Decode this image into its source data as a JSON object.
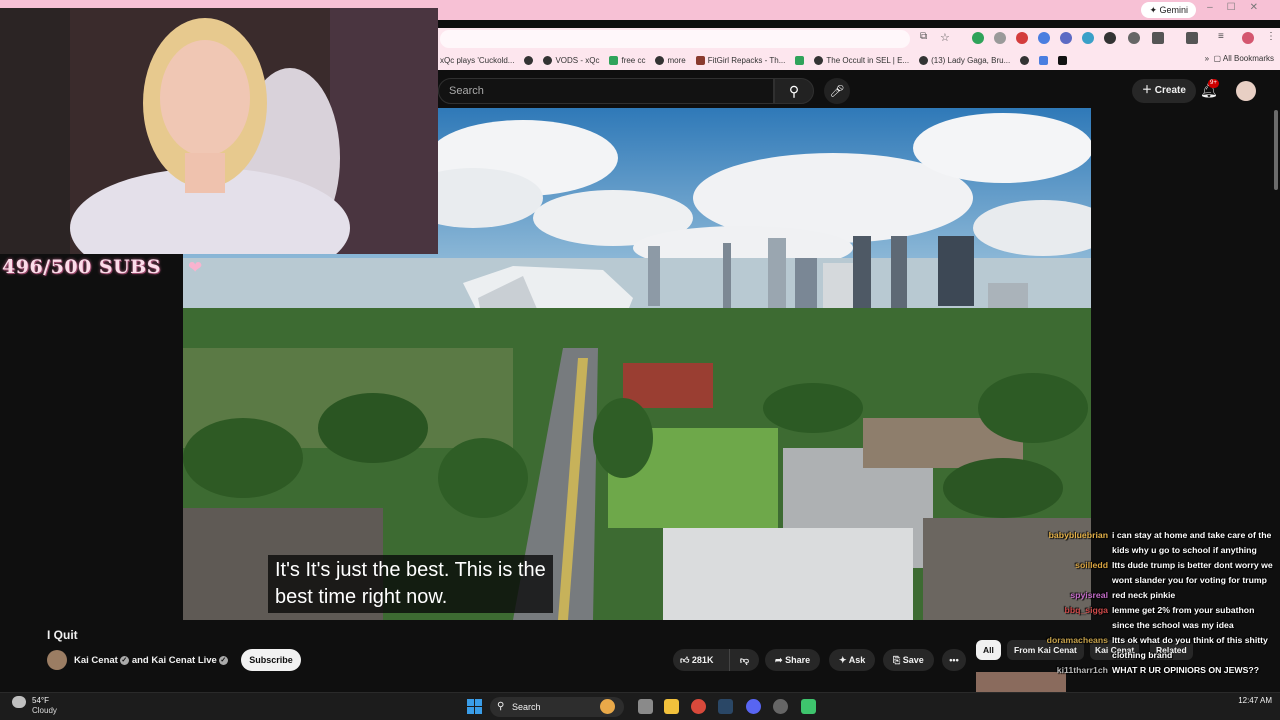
{
  "browser": {
    "gemini_label": "Gemini",
    "bookmarks": [
      "xQc plays 'Cuckold...",
      "",
      "VODS - xQc",
      "free cc",
      "more",
      "FitGirl Repacks - Th...",
      "",
      "The Occult in SEL | E...",
      "(13) Lady Gaga, Bru..."
    ],
    "all_bookmarks": "All Bookmarks"
  },
  "youtube": {
    "search_placeholder": "Search",
    "create_label": "Create",
    "notification_count": "9+"
  },
  "stream_overlay": {
    "sub_goal": "496/500 SUBS",
    "heart_icon": "heart-icon"
  },
  "video": {
    "subtitle_line1": "It's It's just the best. This is the",
    "subtitle_line2": "best time right now.",
    "title": "I Quit",
    "channel_1": "Kai Cenat",
    "channel_and": "and",
    "channel_2": "Kai Cenat Live",
    "subscribe_label": "Subscribe",
    "like_count": "281K",
    "share_label": "Share",
    "ask_label": "Ask",
    "save_label": "Save"
  },
  "filter_chips": [
    "All",
    "From Kai Cenat",
    "Kai Cenat",
    "Related"
  ],
  "chat": [
    {
      "user": "babybluebrian",
      "text": "i can stay at home and take care of the kids why u go to school if anything",
      "color": "#e6b34a"
    },
    {
      "user": "soilledd",
      "text": "ltts dude trump is better dont worry we wont slander you for voting for trump",
      "color": "#d9a441"
    },
    {
      "user": "spyisreal",
      "text": "red neck pinkie",
      "color": "#c46cc9"
    },
    {
      "user": "bbq_sigga",
      "text": "lemme get 2% from your subathon since the school was my idea",
      "color": "#d04b4b"
    },
    {
      "user": "doramacheans",
      "text": "ltts ok what do you think of this shitty clothing brand",
      "color": "#c4a04a"
    },
    {
      "user": "ki11tharr1ch",
      "text": "WHAT R UR OPINIORS ON JEWS??",
      "color": "#b9b9b9"
    }
  ],
  "taskbar": {
    "temperature": "54°F",
    "weather": "Cloudy",
    "search_label": "Search",
    "time": "12:47 AM"
  }
}
